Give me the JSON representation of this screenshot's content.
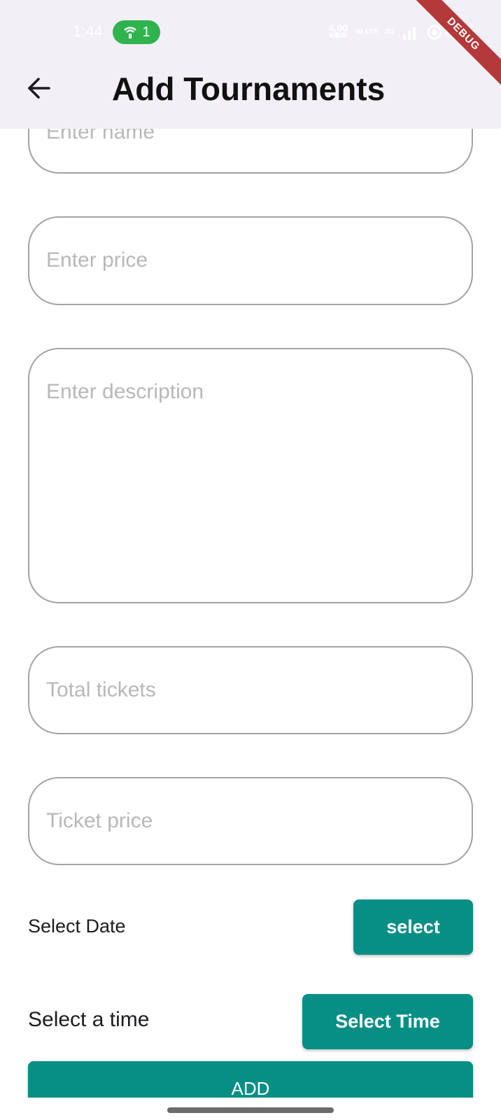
{
  "status_bar": {
    "time": "1:44",
    "hotspot_count": "1",
    "net_speed_value": "4.00",
    "net_speed_unit": "KB/S",
    "volte": "Vo LTE",
    "network": "2G",
    "battery": "69%"
  },
  "app_bar": {
    "title": "Add Tournaments",
    "back_icon": "arrow-left-icon"
  },
  "debug_banner": "DEBUG",
  "form": {
    "name_placeholder": "Enter name",
    "price_placeholder": "Enter price",
    "description_placeholder": "Enter description",
    "total_tickets_placeholder": "Total tickets",
    "ticket_price_placeholder": "Ticket price",
    "date_label": "Select Date",
    "date_button": "select",
    "time_label": "Select a time",
    "time_button": "Select Time",
    "submit_button": "ADD"
  },
  "colors": {
    "accent": "#078f86",
    "app_bar_bg": "#f2eff6",
    "field_border": "#a3a3a3",
    "placeholder": "#b8b8b8",
    "debug": "#b3393a"
  }
}
